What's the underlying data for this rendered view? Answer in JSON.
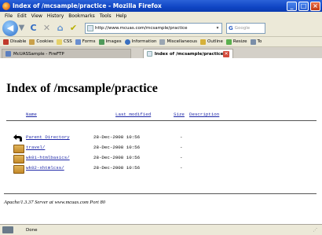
{
  "window": {
    "title": "Index of /mcsample/practice - Mozilla Firefox",
    "buttons": {
      "minimize": "_",
      "maximize": "□",
      "close": "×"
    }
  },
  "menu": [
    "File",
    "Edit",
    "View",
    "History",
    "Bookmarks",
    "Tools",
    "Help"
  ],
  "nav": {
    "url": "http://www.mcuas.com/mcsample/practice",
    "search_placeholder": "Google",
    "search_provider": "G"
  },
  "devbar": [
    "Disable",
    "Cookies",
    "CSS",
    "Forms",
    "Images",
    "Information",
    "Miscellaneous",
    "Outline",
    "Resize",
    "To"
  ],
  "tabs": [
    {
      "label": "McUASSample - FireFTP",
      "active": false
    },
    {
      "label": "Index of /mcsample/practice",
      "active": true
    }
  ],
  "page": {
    "heading": "Index of /mcsample/practice",
    "columns": {
      "name": "Name",
      "modified": "Last modified",
      "size": "Size",
      "description": "Description"
    },
    "rows": [
      {
        "name": "Parent Directory",
        "modified": "28-Dec-2008 10:56",
        "size": "-",
        "icon": "parent-dir-icon"
      },
      {
        "name": "travel/",
        "modified": "28-Dec-2008 10:56",
        "size": "-",
        "icon": "folder-icon"
      },
      {
        "name": "wk01-htmlbasics/",
        "modified": "28-Dec-2008 10:56",
        "size": "-",
        "icon": "folder-icon"
      },
      {
        "name": "wk02-xhtmlcss/",
        "modified": "28-Dec-2008 10:56",
        "size": "-",
        "icon": "folder-icon"
      }
    ],
    "address": "Apache/1.3.37 Server at www.mcuas.com Port 80"
  },
  "status": {
    "text": "Done"
  }
}
